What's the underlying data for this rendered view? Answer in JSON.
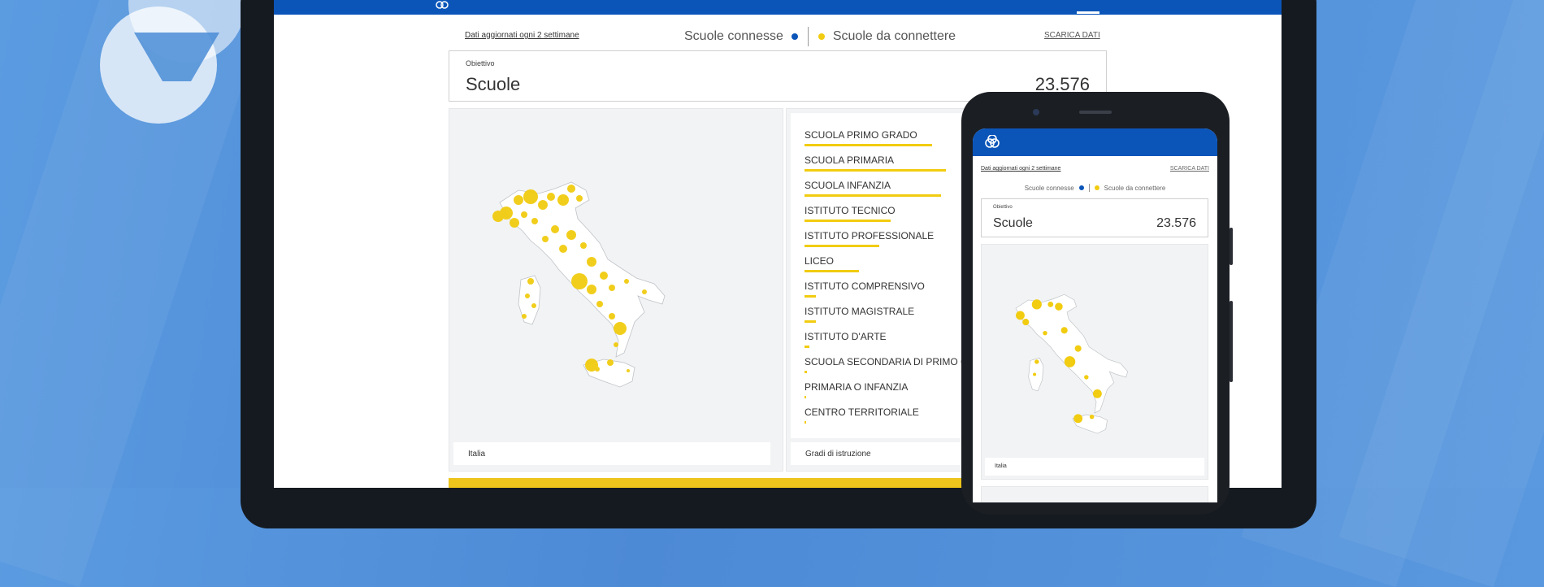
{
  "colors": {
    "primary_blue": "#0b55b9",
    "connected_dot": "#0b55b9",
    "to_connect_dot": "#f1cc10",
    "bar_yellow": "#f1cc10",
    "background_blue": "#5b9be0"
  },
  "header": {
    "nav_a": "",
    "nav_b": ""
  },
  "dashboard": {
    "updated_note": "Dati aggiornati ogni 2 settimane",
    "legend": {
      "connected": "Scuole connesse",
      "to_connect": "Scuole da connettere"
    },
    "download_label": "SCARICA DATI",
    "objective": {
      "label": "Obiettivo",
      "title": "Scuole",
      "value": "23.576"
    },
    "map": {
      "caption": "Italia"
    },
    "grades": {
      "caption": "Gradi di istruzione",
      "items": [
        {
          "label": "SCUOLA PRIMO GRADO",
          "share": 0.56
        },
        {
          "label": "SCUOLA PRIMARIA",
          "share": 0.62
        },
        {
          "label": "SCUOLA INFANZIA",
          "share": 0.6
        },
        {
          "label": "ISTITUTO TECNICO",
          "share": 0.38
        },
        {
          "label": "ISTITUTO PROFESSIONALE",
          "share": 0.33
        },
        {
          "label": "LICEO",
          "share": 0.24
        },
        {
          "label": "ISTITUTO COMPRENSIVO",
          "share": 0.05
        },
        {
          "label": "ISTITUTO MAGISTRALE",
          "share": 0.05
        },
        {
          "label": "ISTITUTO D'ARTE",
          "share": 0.02
        },
        {
          "label": "SCUOLA SECONDARIA DI PRIMO GRADO",
          "share": 0.01
        },
        {
          "label": "PRIMARIA O INFANZIA",
          "share": 0.005
        },
        {
          "label": "CENTRO TERRITORIALE",
          "share": 0.005
        }
      ]
    }
  },
  "phone": {
    "updated_note": "Dati aggiornati ogni 2 settimane",
    "download_label": "SCARICA DATI",
    "legend": {
      "connected": "Scuole connesse",
      "to_connect": "Scuole da connettere"
    },
    "objective": {
      "label": "Obiettivo",
      "title": "Scuole",
      "value": "23.576"
    },
    "map_caption": "Italia"
  }
}
